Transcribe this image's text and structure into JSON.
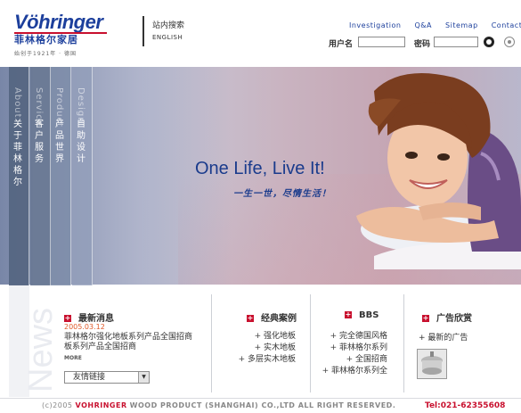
{
  "header": {
    "brand": "Vöhringer",
    "brand_cn": "菲林格尔家居",
    "tagline": "始创于1921年 · 德国",
    "site_search": "站内搜索",
    "english": "ENGLISH",
    "nav": [
      "Investigation",
      "Q&A",
      "Sitemap",
      "Contact"
    ],
    "user_label": "用户名",
    "password_label": "密码"
  },
  "sidebar_tabs": [
    {
      "en": "About",
      "cn": "关于菲林格尔"
    },
    {
      "en": "Service",
      "cn": "客户服务"
    },
    {
      "en": "Product",
      "cn": "产品世界"
    },
    {
      "en": "Design",
      "cn": "自助设计"
    }
  ],
  "banner": {
    "slogan": "One Life, Live It!",
    "slogan_cn": "一生一世，尽情生活！"
  },
  "news": {
    "watermark": "News",
    "title": "最新消息",
    "date": "2005.03.12",
    "item": "菲林格尔强化地板系列产品全国招商板系列产品全国招商",
    "more": "MORE",
    "links_select": "友情链接"
  },
  "cases": {
    "title": "经典案例",
    "items": [
      "强化地板",
      "实木地板",
      "多层实木地板"
    ]
  },
  "bbs": {
    "title": "BBS",
    "items": [
      "完全德国风格",
      "菲林格尔系列",
      "全国招商",
      "菲林格尔系列全"
    ]
  },
  "ads": {
    "title": "广告欣赏",
    "item": "最新的广告"
  },
  "footer": {
    "copyright": "(c)2005",
    "company": "VOHRINGER",
    "rest": "WOOD PRODUCT (SHANGHAI) CO.,LTD   ALL RIGHT RESERVED.",
    "phone": "Tel:021-62355608"
  },
  "colors": {
    "brand_blue": "#1c3f9c",
    "accent_red": "#c8102e"
  }
}
